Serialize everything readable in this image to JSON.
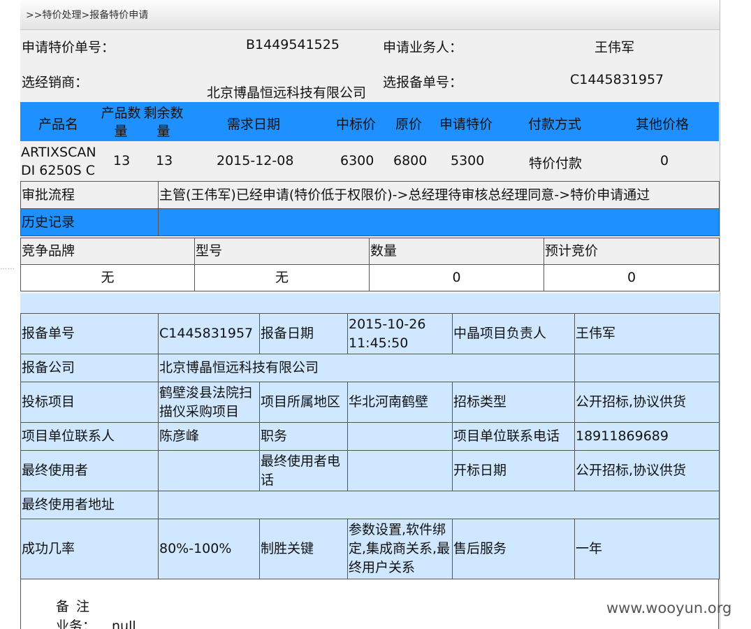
{
  "breadcrumb": ">>特价处理>报备特价申请",
  "request": {
    "order_no_label": "申请特价单号：",
    "order_no": "B1449541525",
    "salesperson_label": "申请业务人：",
    "salesperson": "王伟军",
    "dealer_label": "选经销商：",
    "dealer": "北京博晶恒远科技有限公司",
    "filing_no_label": "选报备单号：",
    "filing_no": "C1445831957"
  },
  "product_table": {
    "headers": [
      "产品名",
      "产品数量",
      "剩余数量",
      "需求日期",
      "中标价",
      "原价",
      "申请特价",
      "付款方式",
      "其他价格"
    ],
    "row": {
      "name": "ARTIXSCAN DI 6250S C",
      "qty": "13",
      "remaining": "13",
      "date": "2015-12-08",
      "bid_price": "6300",
      "original_price": "6800",
      "special_price": "5300",
      "payment": "特价付款",
      "other_price": "0"
    }
  },
  "approval": {
    "flow_label": "审批流程",
    "flow_text": "主管(王伟军)已经申请(特价低于权限价)->总经理待审核总经理同意->特价申请通过",
    "history_label": "历史记录"
  },
  "competition": {
    "headers": [
      "竞争品牌",
      "型号",
      "数量",
      "预计竞价"
    ],
    "values": [
      "无",
      "无",
      "0",
      "0"
    ]
  },
  "filing": {
    "no_label": "报备单号",
    "no": "C1445831957",
    "date_label": "报备日期",
    "date": "2015-10-26 11:45:50",
    "owner_label": "中晶项目负责人",
    "owner": "王伟军",
    "company_label": "报备公司",
    "company": "北京博晶恒远科技有限公司",
    "project_label": "投标项目",
    "project": "鹤壁浚县法院扫描仪采购项目",
    "region_label": "项目所属地区",
    "region": "华北河南鹤壁",
    "tender_type_label": "招标类型",
    "tender_type": "公开招标,协议供货",
    "contact_label": "项目单位联系人",
    "contact": "陈彦峰",
    "position_label": "职务",
    "position": "",
    "phone_label": "项目单位联系电话",
    "phone": "18911869689",
    "end_user_label": "最终使用者",
    "end_user": "",
    "end_user_phone_label": "最终使用者电话",
    "end_user_phone": "",
    "open_date_label": "开标日期",
    "open_date": "公开招标,协议供货",
    "end_user_addr_label": "最终使用者地址",
    "end_user_addr": "",
    "success_rate_label": "成功几率",
    "success_rate": "80%-100%",
    "key_label": "制胜关键",
    "key": "参数设置,软件绑定,集成商关系,最终用户关系",
    "after_sales_label": "售后服务",
    "after_sales": "一年"
  },
  "remarks": {
    "title": "备注",
    "business_label": "业务：",
    "business_value": "null"
  },
  "watermark": "www.wooyun.org"
}
